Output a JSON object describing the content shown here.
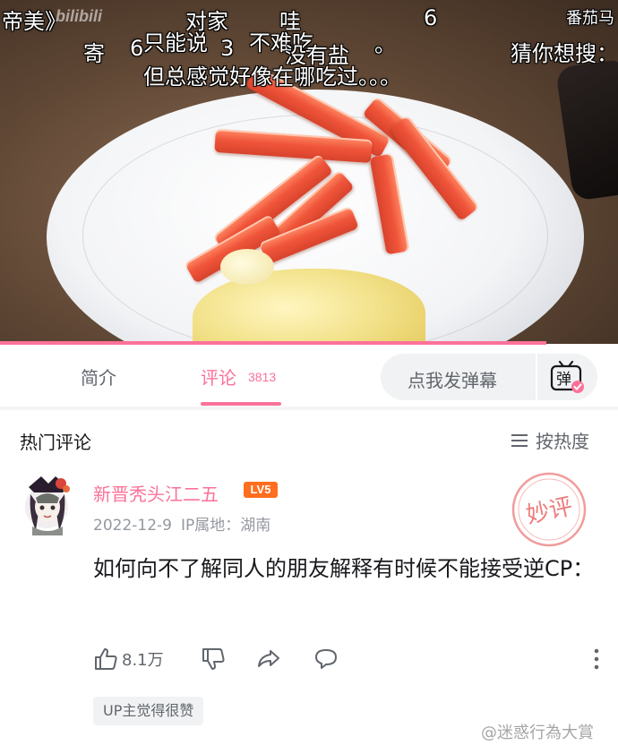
{
  "video": {
    "danmaku": [
      "帝美》",
      "对家",
      "哇",
      "6",
      "番茄马",
      "寄",
      "6",
      "只能说",
      "3",
      "不难吃",
      "没有盐",
      "。",
      "猜你想搜：",
      "但总感觉好像在哪吃过。。。"
    ],
    "logo_text": "bilibili"
  },
  "tabs": {
    "intro_label": "简介",
    "comment_label": "评论",
    "comment_count": "3813",
    "danmaku_placeholder": "点我发弹幕",
    "danmaku_toggle": "弹"
  },
  "comments": {
    "section_title": "热门评论",
    "sort_label": "按热度",
    "items": [
      {
        "username": "新晋秃头江二五",
        "level": "LV5",
        "date": "2022-12-9",
        "ip_location": "IP属地：湖南",
        "stamp_text": "妙评",
        "content": "如何向不了解同人的朋友解释有时候不能接受逆CP：",
        "like_count": "8.1万",
        "up_badge": "UP主觉得很赞"
      }
    ]
  },
  "watermark": "@迷惑行為大賞",
  "colors": {
    "accent": "#fb7299",
    "level_badge": "#ff6d1e",
    "text_primary": "#18191c",
    "text_secondary": "#61666d",
    "text_meta": "#9499a0"
  }
}
